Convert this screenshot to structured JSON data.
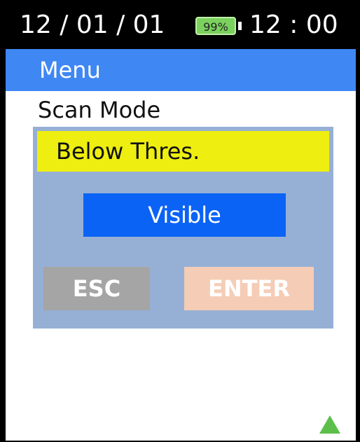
{
  "status_bar": {
    "date": "12 / 01 / 01",
    "battery": "99%",
    "time": "12 : 00"
  },
  "menu": {
    "title": "Menu",
    "items": [
      {
        "label": "Scan Mode"
      }
    ]
  },
  "dialog": {
    "header": "Below Thres.",
    "value": "Visible",
    "esc_label": "ESC",
    "enter_label": "ENTER"
  },
  "icons": {
    "scroll": "triangle-up-icon"
  },
  "colors": {
    "menu_bar": "#3f87f3",
    "dialog_bg": "#96b0d5",
    "dialog_header": "#eeee10",
    "value_field": "#0b63f6",
    "esc_button": "#a5a5a5",
    "enter_button": "#f5ccb5",
    "battery": "#7bd15e",
    "scroll_icon": "#5cbf4a"
  }
}
